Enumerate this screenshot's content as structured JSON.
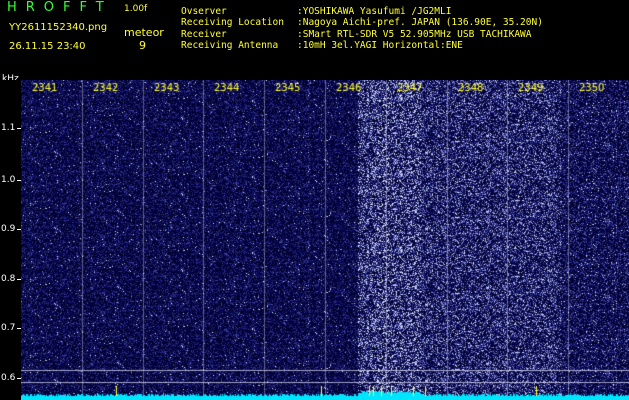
{
  "app": {
    "title": "HROFFT",
    "version": "1.00f",
    "filename": "YY2611152340.png",
    "datetime": "26.11.15 23:40",
    "mode_label": "meteor",
    "meteor_count": "9"
  },
  "info": [
    {
      "label": "Ovserver",
      "value": ":YOSHIKAWA Yasufumi /JG2MLI"
    },
    {
      "label": "Receiving Location",
      "value": ":Nagoya Aichi-pref. JAPAN (136.90E, 35.20N)"
    },
    {
      "label": "Receiver",
      "value": ":SMart RTL-SDR V5 52.905MHz USB TACHIKAWA"
    },
    {
      "label": "Receiving Antenna",
      "value": ":10mH 3el.YAGI Horizontal:ENE"
    }
  ],
  "axis": {
    "unit": "kHz",
    "freq_ticks": [
      "1.1",
      "1.0",
      "0.9",
      "0.8",
      "0.7",
      "0.6"
    ],
    "time_ticks": [
      "2341",
      "2342",
      "2343",
      "2344",
      "2345",
      "2346",
      "2347",
      "2348",
      "2349",
      "2350"
    ]
  },
  "colors": {
    "background": "#000000",
    "spectrogram_base": "#000040",
    "header_text": "#33ff33",
    "label_text": "#ffff33",
    "baseline": "#00ffff"
  }
}
